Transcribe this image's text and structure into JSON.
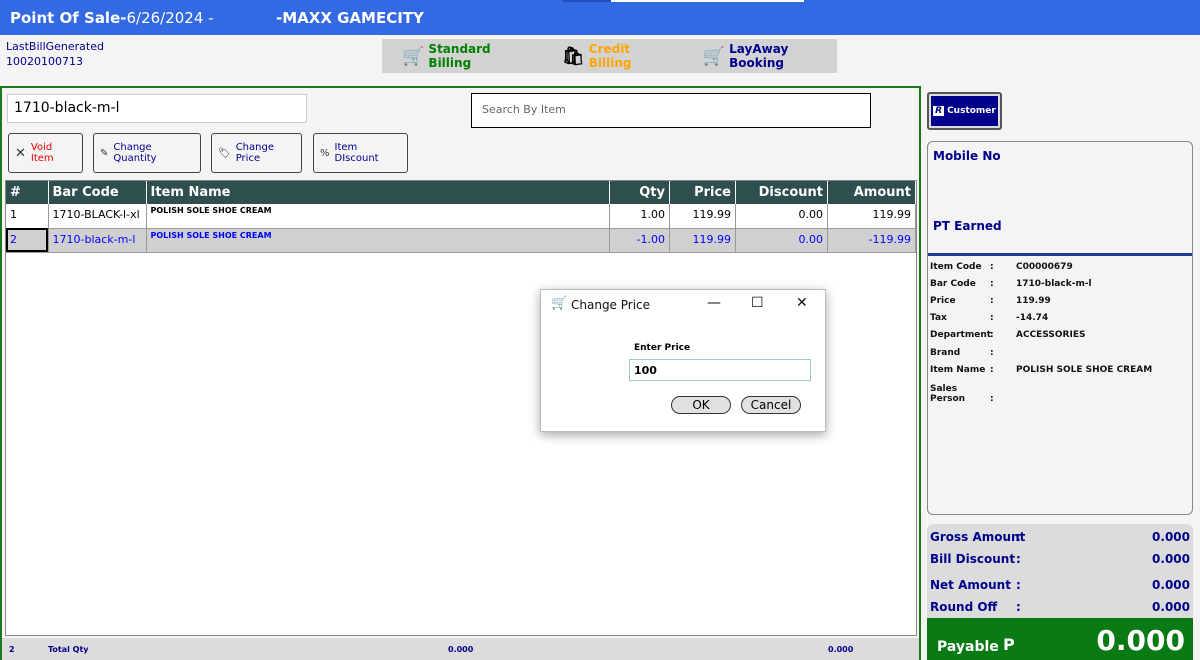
{
  "header": {
    "title": "Point Of Sale-",
    "date": "6/26/2024",
    "sep": " -",
    "store": "-MAXX GAMECITY"
  },
  "last_bill": {
    "label": "LastBillGenerated",
    "number": "10020100713"
  },
  "billing_tabs": [
    {
      "label": "Standard Billing",
      "color": "#008000"
    },
    {
      "label": "Credit Billing",
      "color": "#ffa500"
    },
    {
      "label": "LayAway Booking",
      "color": "#00008b"
    }
  ],
  "scan_value": "1710-black-m-l",
  "search_placeholder": "Search By Item",
  "actions": {
    "void": "Void Item",
    "qty": "Change Quantity",
    "price": "Change Price",
    "discount": "Item DIscount"
  },
  "table": {
    "headers": [
      "#",
      "Bar Code",
      "Item Name",
      "Qty",
      "Price",
      "Discount",
      "Amount"
    ],
    "rows": [
      [
        "1",
        "1710-BLACK-l-xl",
        "POLISH SOLE SHOE CREAM",
        "1.00",
        "119.99",
        "0.00",
        "119.99"
      ],
      [
        "2",
        "1710-black-m-l",
        "POLISH SOLE SHOE CREAM",
        "-1.00",
        "119.99",
        "0.00",
        "-119.99"
      ]
    ]
  },
  "footer": {
    "count": "2",
    "label": "Total Qty",
    "qty": "0.000",
    "amount": "0.000"
  },
  "customer_btn": "Customer",
  "info": {
    "mobile": "Mobile No",
    "points": "PT Earned",
    "details": [
      [
        "Item Code",
        "C00000679"
      ],
      [
        "Bar Code",
        "1710-black-m-l"
      ],
      [
        "Price",
        "119.99"
      ],
      [
        "Tax",
        "-14.74"
      ],
      [
        "Department",
        "ACCESSORIES"
      ],
      [
        "Brand",
        ""
      ],
      [
        "Item Name",
        "POLISH SOLE SHOE CREAM"
      ],
      [
        "Sales Person",
        ""
      ]
    ]
  },
  "totals": [
    [
      "Gross Amount",
      "0.000"
    ],
    [
      "Bill Discount",
      "0.000"
    ],
    [
      "Net Amount",
      "0.000"
    ],
    [
      "Round Off",
      "0.000"
    ]
  ],
  "payable": {
    "label": "Payable",
    "currency": "P",
    "value": "0.000"
  },
  "dialog": {
    "title": "Change Price",
    "prompt": "Enter Price",
    "value": "100",
    "ok": "OK",
    "cancel": "Cancel"
  }
}
